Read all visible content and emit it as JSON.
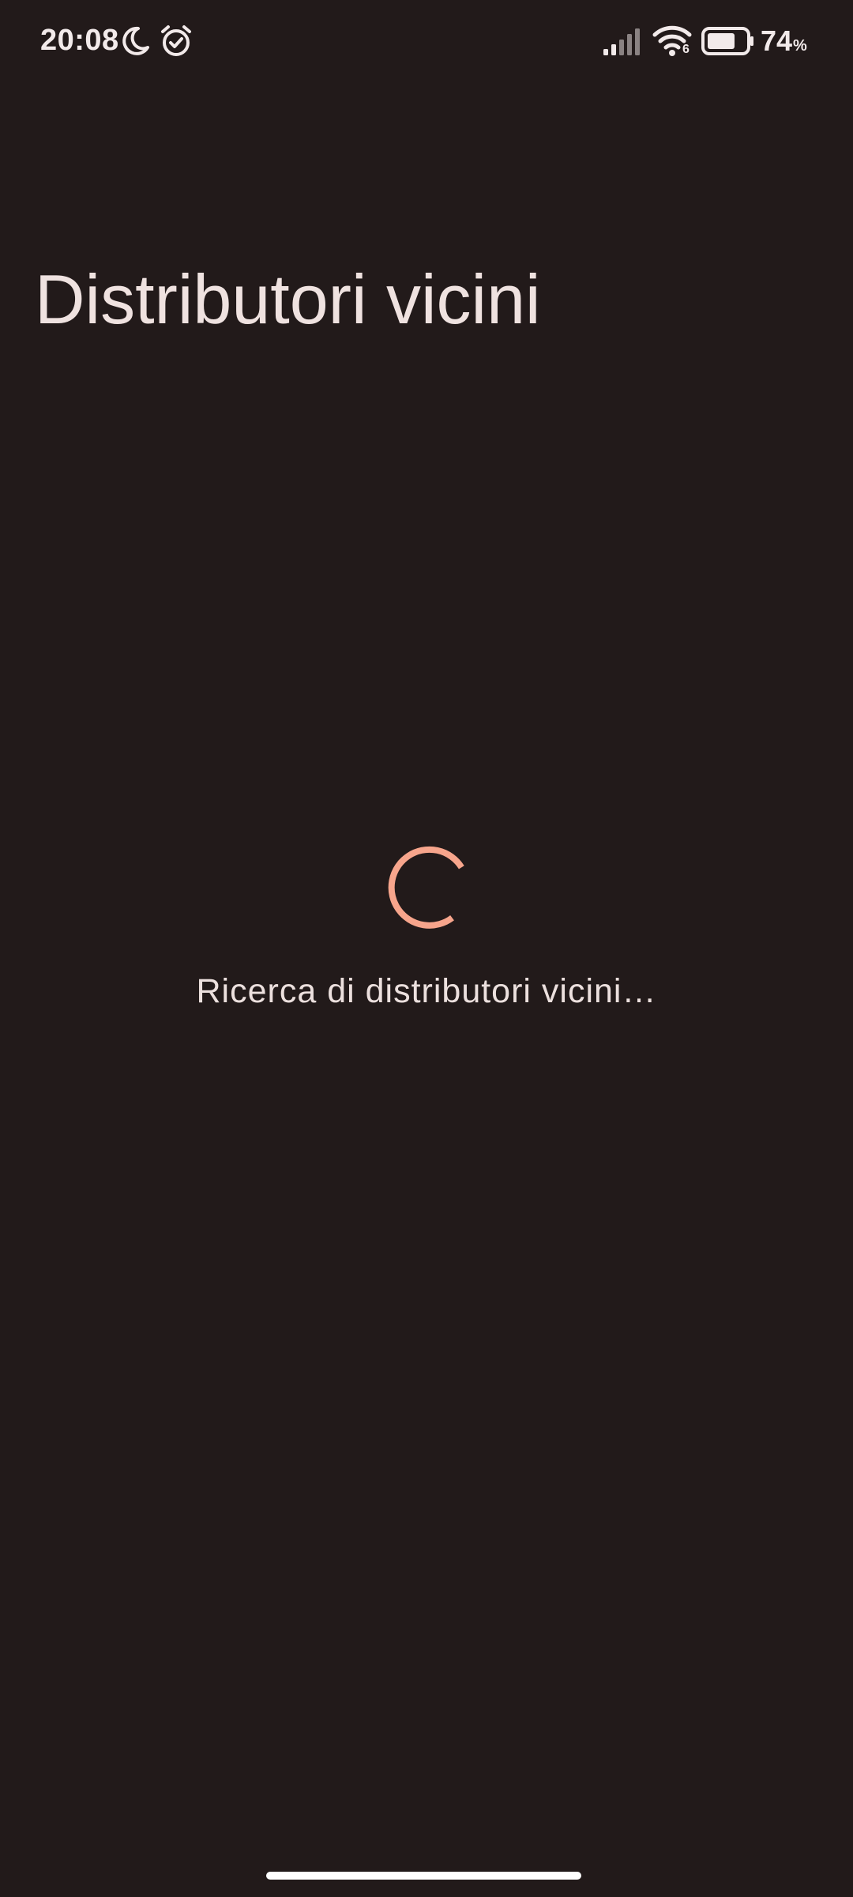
{
  "status_bar": {
    "time": "20:08",
    "battery_percent": "74",
    "battery_percent_sign": "%",
    "wifi_generation": "6",
    "icons": [
      "moon-icon",
      "alarm-icon",
      "signal-icon",
      "wifi-icon",
      "battery-icon"
    ],
    "battery_level": 0.74
  },
  "header": {
    "title": "Distributori vicini"
  },
  "loading": {
    "message": "Ricerca di distributori vicini…",
    "spinner_color": "#f7a58c"
  },
  "theme": {
    "background": "#221a1a",
    "text": "#efe2e0",
    "accent": "#f7a58c"
  }
}
